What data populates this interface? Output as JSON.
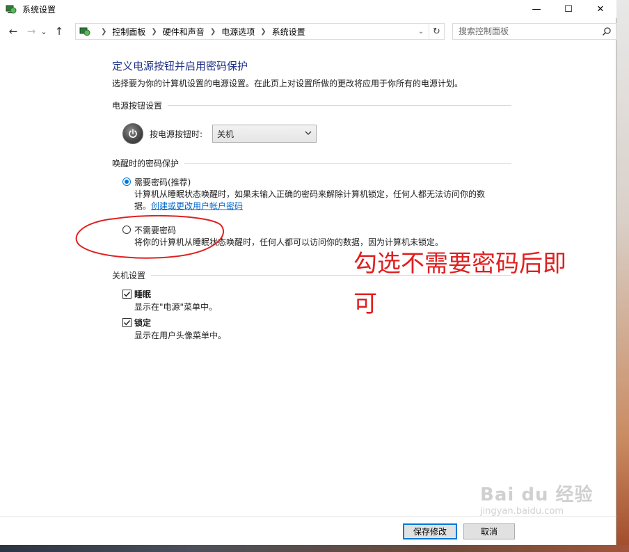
{
  "window": {
    "title": "系统设置",
    "controls": {
      "minimize": "—",
      "maximize": "☐",
      "close": "✕"
    }
  },
  "nav": {
    "back": "←",
    "forward": "→",
    "recent": "⌄",
    "up": "↑",
    "breadcrumbs": [
      "控制面板",
      "硬件和声音",
      "电源选项",
      "系统设置"
    ],
    "dropdown": "⌄",
    "refresh": "↻",
    "search_placeholder": "搜索控制面板"
  },
  "page": {
    "title": "定义电源按钮并启用密码保护",
    "description": "选择要为你的计算机设置的电源设置。在此页上对设置所做的更改将应用于你所有的电源计划。"
  },
  "power_section": {
    "header": "电源按钮设置",
    "label": "按电源按钮时:",
    "selected": "关机"
  },
  "password_section": {
    "header": "唤醒时的密码保护",
    "options": [
      {
        "label": "需要密码(推荐)",
        "checked": true,
        "desc_line1": "计算机从睡眠状态唤醒时，如果未输入正确的密码来解除计算机锁定，任何人都无法访问你的数",
        "desc_line2_prefix": "据。",
        "link": "创建或更改用户帐户密码"
      },
      {
        "label": "不需要密码",
        "checked": false,
        "desc": "将你的计算机从睡眠状态唤醒时，任何人都可以访问你的数据，因为计算机未锁定。"
      }
    ]
  },
  "shutdown_section": {
    "header": "关机设置",
    "items": [
      {
        "label": "睡眠",
        "checked": true,
        "desc": "显示在\"电源\"菜单中。"
      },
      {
        "label": "锁定",
        "checked": true,
        "desc": "显示在用户头像菜单中。"
      }
    ]
  },
  "annotation": {
    "text": "勾选不需要密码后即可",
    "color": "#e02020"
  },
  "footer": {
    "save": "保存修改",
    "cancel": "取消"
  },
  "watermark": {
    "brand": "Bai du 经验",
    "url": "jingyan.baidu.com"
  },
  "colors": {
    "title": "#1e3287",
    "link": "#0066cc",
    "accent": "#0078d7"
  }
}
